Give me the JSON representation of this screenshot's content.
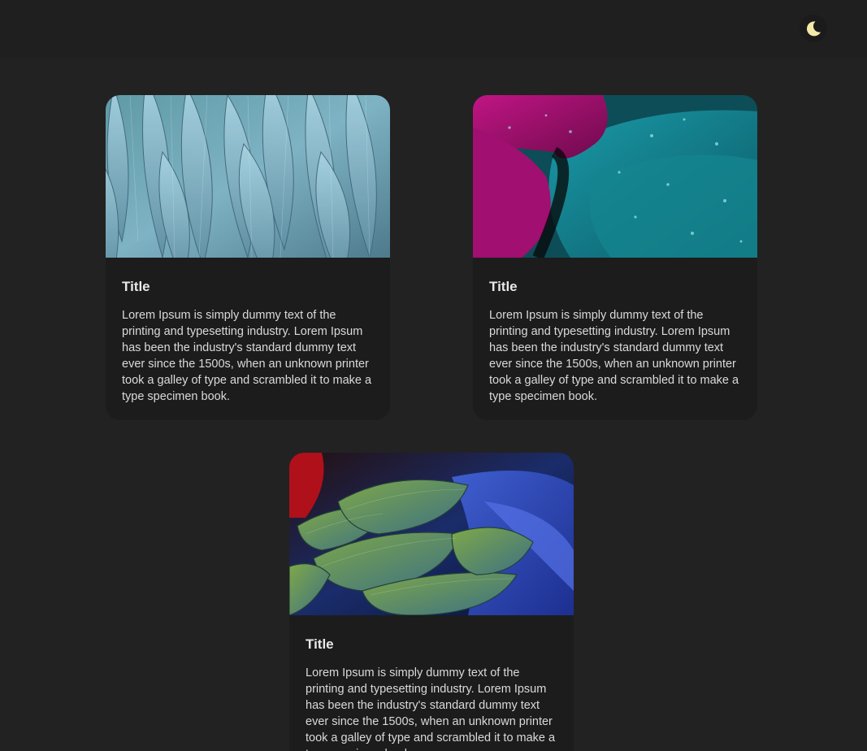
{
  "header": {
    "theme_toggle_icon": "moon-icon",
    "moon_color": "#f5e9a8"
  },
  "cards": [
    {
      "image": "blue-feathers-photo",
      "title": "Title",
      "text": "Lorem Ipsum is simply dummy text of the printing and typesetting industry. Lorem Ipsum has been the industry's standard dummy text ever since the 1500s, when an unknown printer took a galley of type and scrambled it to make a type specimen book."
    },
    {
      "image": "teal-magenta-feathers-photo",
      "title": "Title",
      "text": "Lorem Ipsum is simply dummy text of the printing and typesetting industry. Lorem Ipsum has been the industry's standard dummy text ever since the 1500s, when an unknown printer took a galley of type and scrambled it to make a type specimen book."
    },
    {
      "image": "green-blue-parrot-feathers-photo",
      "title": "Title",
      "text": "Lorem Ipsum is simply dummy text of the printing and typesetting industry. Lorem Ipsum has been the industry's standard dummy text ever since the 1500s, when an unknown printer took a galley of type and scrambled it to make a type specimen book."
    }
  ],
  "colors": {
    "background": "#222222",
    "header_background": "#1f1f1f",
    "card_background": "#1c1c1c"
  }
}
